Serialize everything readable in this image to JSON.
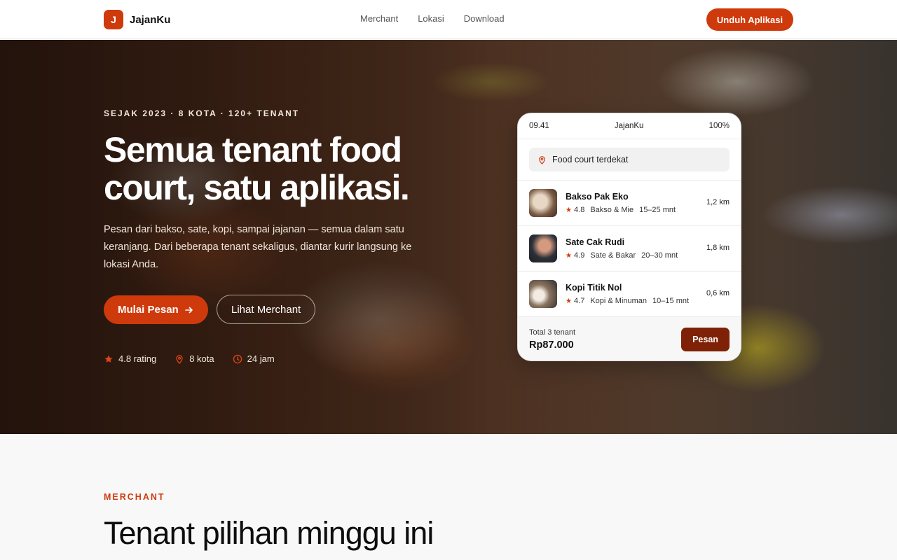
{
  "nav": {
    "logo_letter": "J",
    "brand": "JajanKu",
    "links": [
      "Merchant",
      "Lokasi",
      "Download"
    ],
    "cta": "Unduh Aplikasi"
  },
  "hero": {
    "eyebrow": "SEJAK 2023 · 8 KOTA · 120+ TENANT",
    "title": "Semua tenant food court, satu aplikasi.",
    "description": "Pesan dari bakso, sate, kopi, sampai jajanan — semua dalam satu keranjang. Dari beberapa tenant sekaligus, diantar kurir langsung ke lokasi Anda.",
    "primary_button": "Mulai Pesan",
    "secondary_button": "Lihat Merchant",
    "stats": [
      {
        "icon": "star-icon",
        "label": "4.8 rating"
      },
      {
        "icon": "location-pin-icon",
        "label": "8 kota"
      },
      {
        "icon": "clock-icon",
        "label": "24 jam"
      }
    ]
  },
  "phone": {
    "time": "09.41",
    "app_name": "JajanKu",
    "battery": "100%",
    "search_placeholder": "Food court terdekat",
    "tenants": [
      {
        "name": "Bakso Pak Eko",
        "rating": "4.8",
        "category": "Bakso & Mie",
        "eta": "15–25 mnt",
        "distance": "1,2 km"
      },
      {
        "name": "Sate Cak Rudi",
        "rating": "4.9",
        "category": "Sate & Bakar",
        "eta": "20–30 mnt",
        "distance": "1,8 km"
      },
      {
        "name": "Kopi Titik Nol",
        "rating": "4.7",
        "category": "Kopi & Minuman",
        "eta": "10–15 mnt",
        "distance": "0,6 km"
      }
    ],
    "footer_label": "Total 3 tenant",
    "footer_total": "Rp87.000",
    "order_button": "Pesan"
  },
  "section": {
    "eyebrow": "MERCHANT",
    "title": "Tenant pilihan minggu ini"
  },
  "colors": {
    "accent": "#cf3a0c",
    "accent_dark": "#7e2106"
  }
}
